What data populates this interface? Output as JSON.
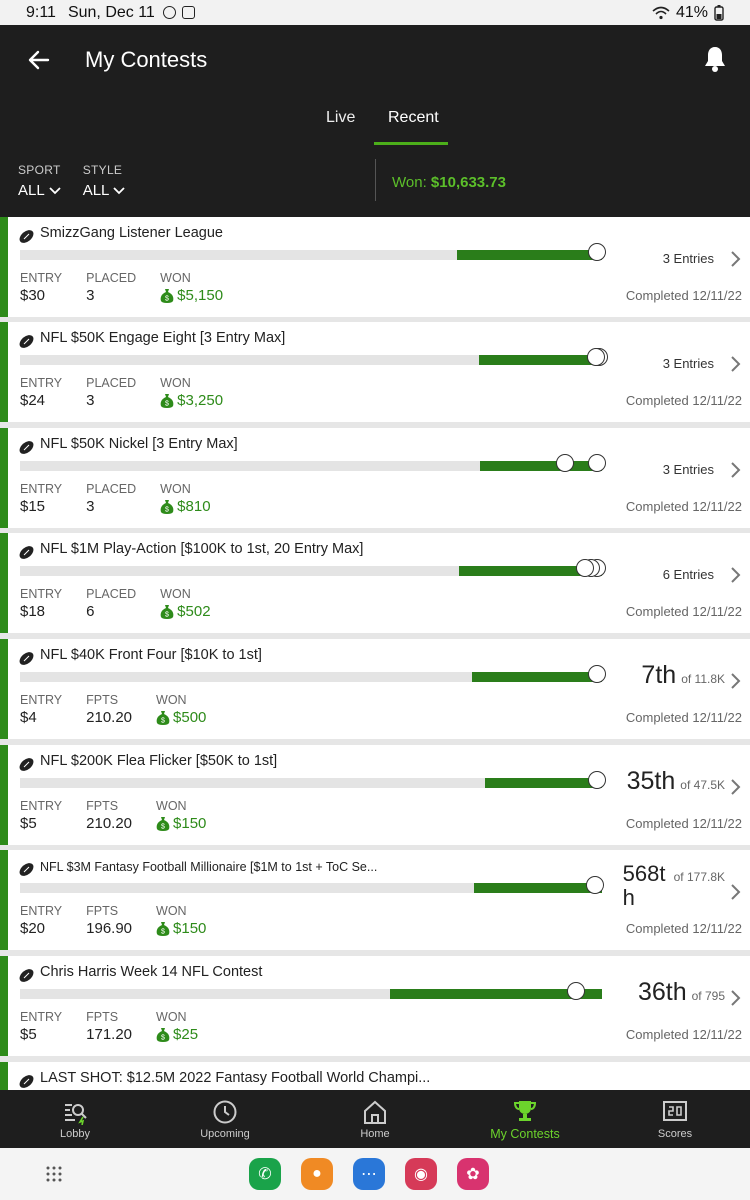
{
  "status_bar": {
    "time": "9:11",
    "date": "Sun, Dec 11",
    "battery": "41%"
  },
  "header": {
    "title": "My Contests"
  },
  "tabs": [
    {
      "label": "Live"
    },
    {
      "label": "Recent"
    }
  ],
  "filters": [
    {
      "label": "SPORT",
      "value": "ALL"
    },
    {
      "label": "STYLE",
      "value": "ALL"
    }
  ],
  "won_total": {
    "label": "Won:",
    "value": "$10,633.73"
  },
  "contests": [
    {
      "name": "SmizzGang Listener League",
      "stats": [
        {
          "label": "ENTRY",
          "value": "$30"
        },
        {
          "label": "PLACED",
          "value": "3"
        },
        {
          "label": "WON",
          "value": "$5,150"
        }
      ],
      "entries": "3 Entries",
      "completed": "Completed 12/11/22"
    },
    {
      "name": "NFL $50K Engage Eight [3 Entry Max]",
      "stats": [
        {
          "label": "ENTRY",
          "value": "$24"
        },
        {
          "label": "PLACED",
          "value": "3"
        },
        {
          "label": "WON",
          "value": "$3,250"
        }
      ],
      "entries": "3 Entries",
      "completed": "Completed 12/11/22"
    },
    {
      "name": "NFL $50K Nickel [3 Entry Max]",
      "stats": [
        {
          "label": "ENTRY",
          "value": "$15"
        },
        {
          "label": "PLACED",
          "value": "3"
        },
        {
          "label": "WON",
          "value": "$810"
        }
      ],
      "entries": "3 Entries",
      "completed": "Completed 12/11/22"
    },
    {
      "name": "NFL $1M Play-Action [$100K to 1st, 20 Entry Max]",
      "stats": [
        {
          "label": "ENTRY",
          "value": "$18"
        },
        {
          "label": "PLACED",
          "value": "6"
        },
        {
          "label": "WON",
          "value": "$502"
        }
      ],
      "entries": "6 Entries",
      "completed": "Completed 12/11/22"
    },
    {
      "name": "NFL $40K Front Four [$10K to 1st]",
      "stats": [
        {
          "label": "ENTRY",
          "value": "$4"
        },
        {
          "label": "FPTS",
          "value": "210.20"
        },
        {
          "label": "WON",
          "value": "$500"
        }
      ],
      "rank": "7th",
      "of": "of 11.8K",
      "completed": "Completed 12/11/22"
    },
    {
      "name": "NFL $200K Flea Flicker [$50K to 1st]",
      "stats": [
        {
          "label": "ENTRY",
          "value": "$5"
        },
        {
          "label": "FPTS",
          "value": "210.20"
        },
        {
          "label": "WON",
          "value": "$150"
        }
      ],
      "rank": "35th",
      "of": "of 47.5K",
      "completed": "Completed 12/11/22"
    },
    {
      "name": "NFL $3M Fantasy Football Millionaire [$1M to 1st + ToC Se...",
      "stats": [
        {
          "label": "ENTRY",
          "value": "$20"
        },
        {
          "label": "FPTS",
          "value": "196.90"
        },
        {
          "label": "WON",
          "value": "$150"
        }
      ],
      "rank": "568th",
      "of": "of 177.8K",
      "completed": "Completed 12/11/22"
    },
    {
      "name": "Chris Harris Week 14 NFL Contest",
      "stats": [
        {
          "label": "ENTRY",
          "value": "$5"
        },
        {
          "label": "FPTS",
          "value": "171.20"
        },
        {
          "label": "WON",
          "value": "$25"
        }
      ],
      "rank": "36th",
      "of": "of 795",
      "completed": "Completed 12/11/22"
    },
    {
      "name": "LAST SHOT: $12.5M 2022 Fantasy Football World Champi..."
    }
  ],
  "nav": [
    {
      "label": "Lobby",
      "icon": "lobby-icon"
    },
    {
      "label": "Upcoming",
      "icon": "clock-icon"
    },
    {
      "label": "Home",
      "icon": "home-icon"
    },
    {
      "label": "My Contests",
      "icon": "trophy-icon"
    },
    {
      "label": "Scores",
      "icon": "scoreboard-icon"
    }
  ],
  "colors": {
    "accent": "#4caf1a",
    "bar_fill": "#2a7d1a",
    "header_bg": "#1e1e1e"
  }
}
